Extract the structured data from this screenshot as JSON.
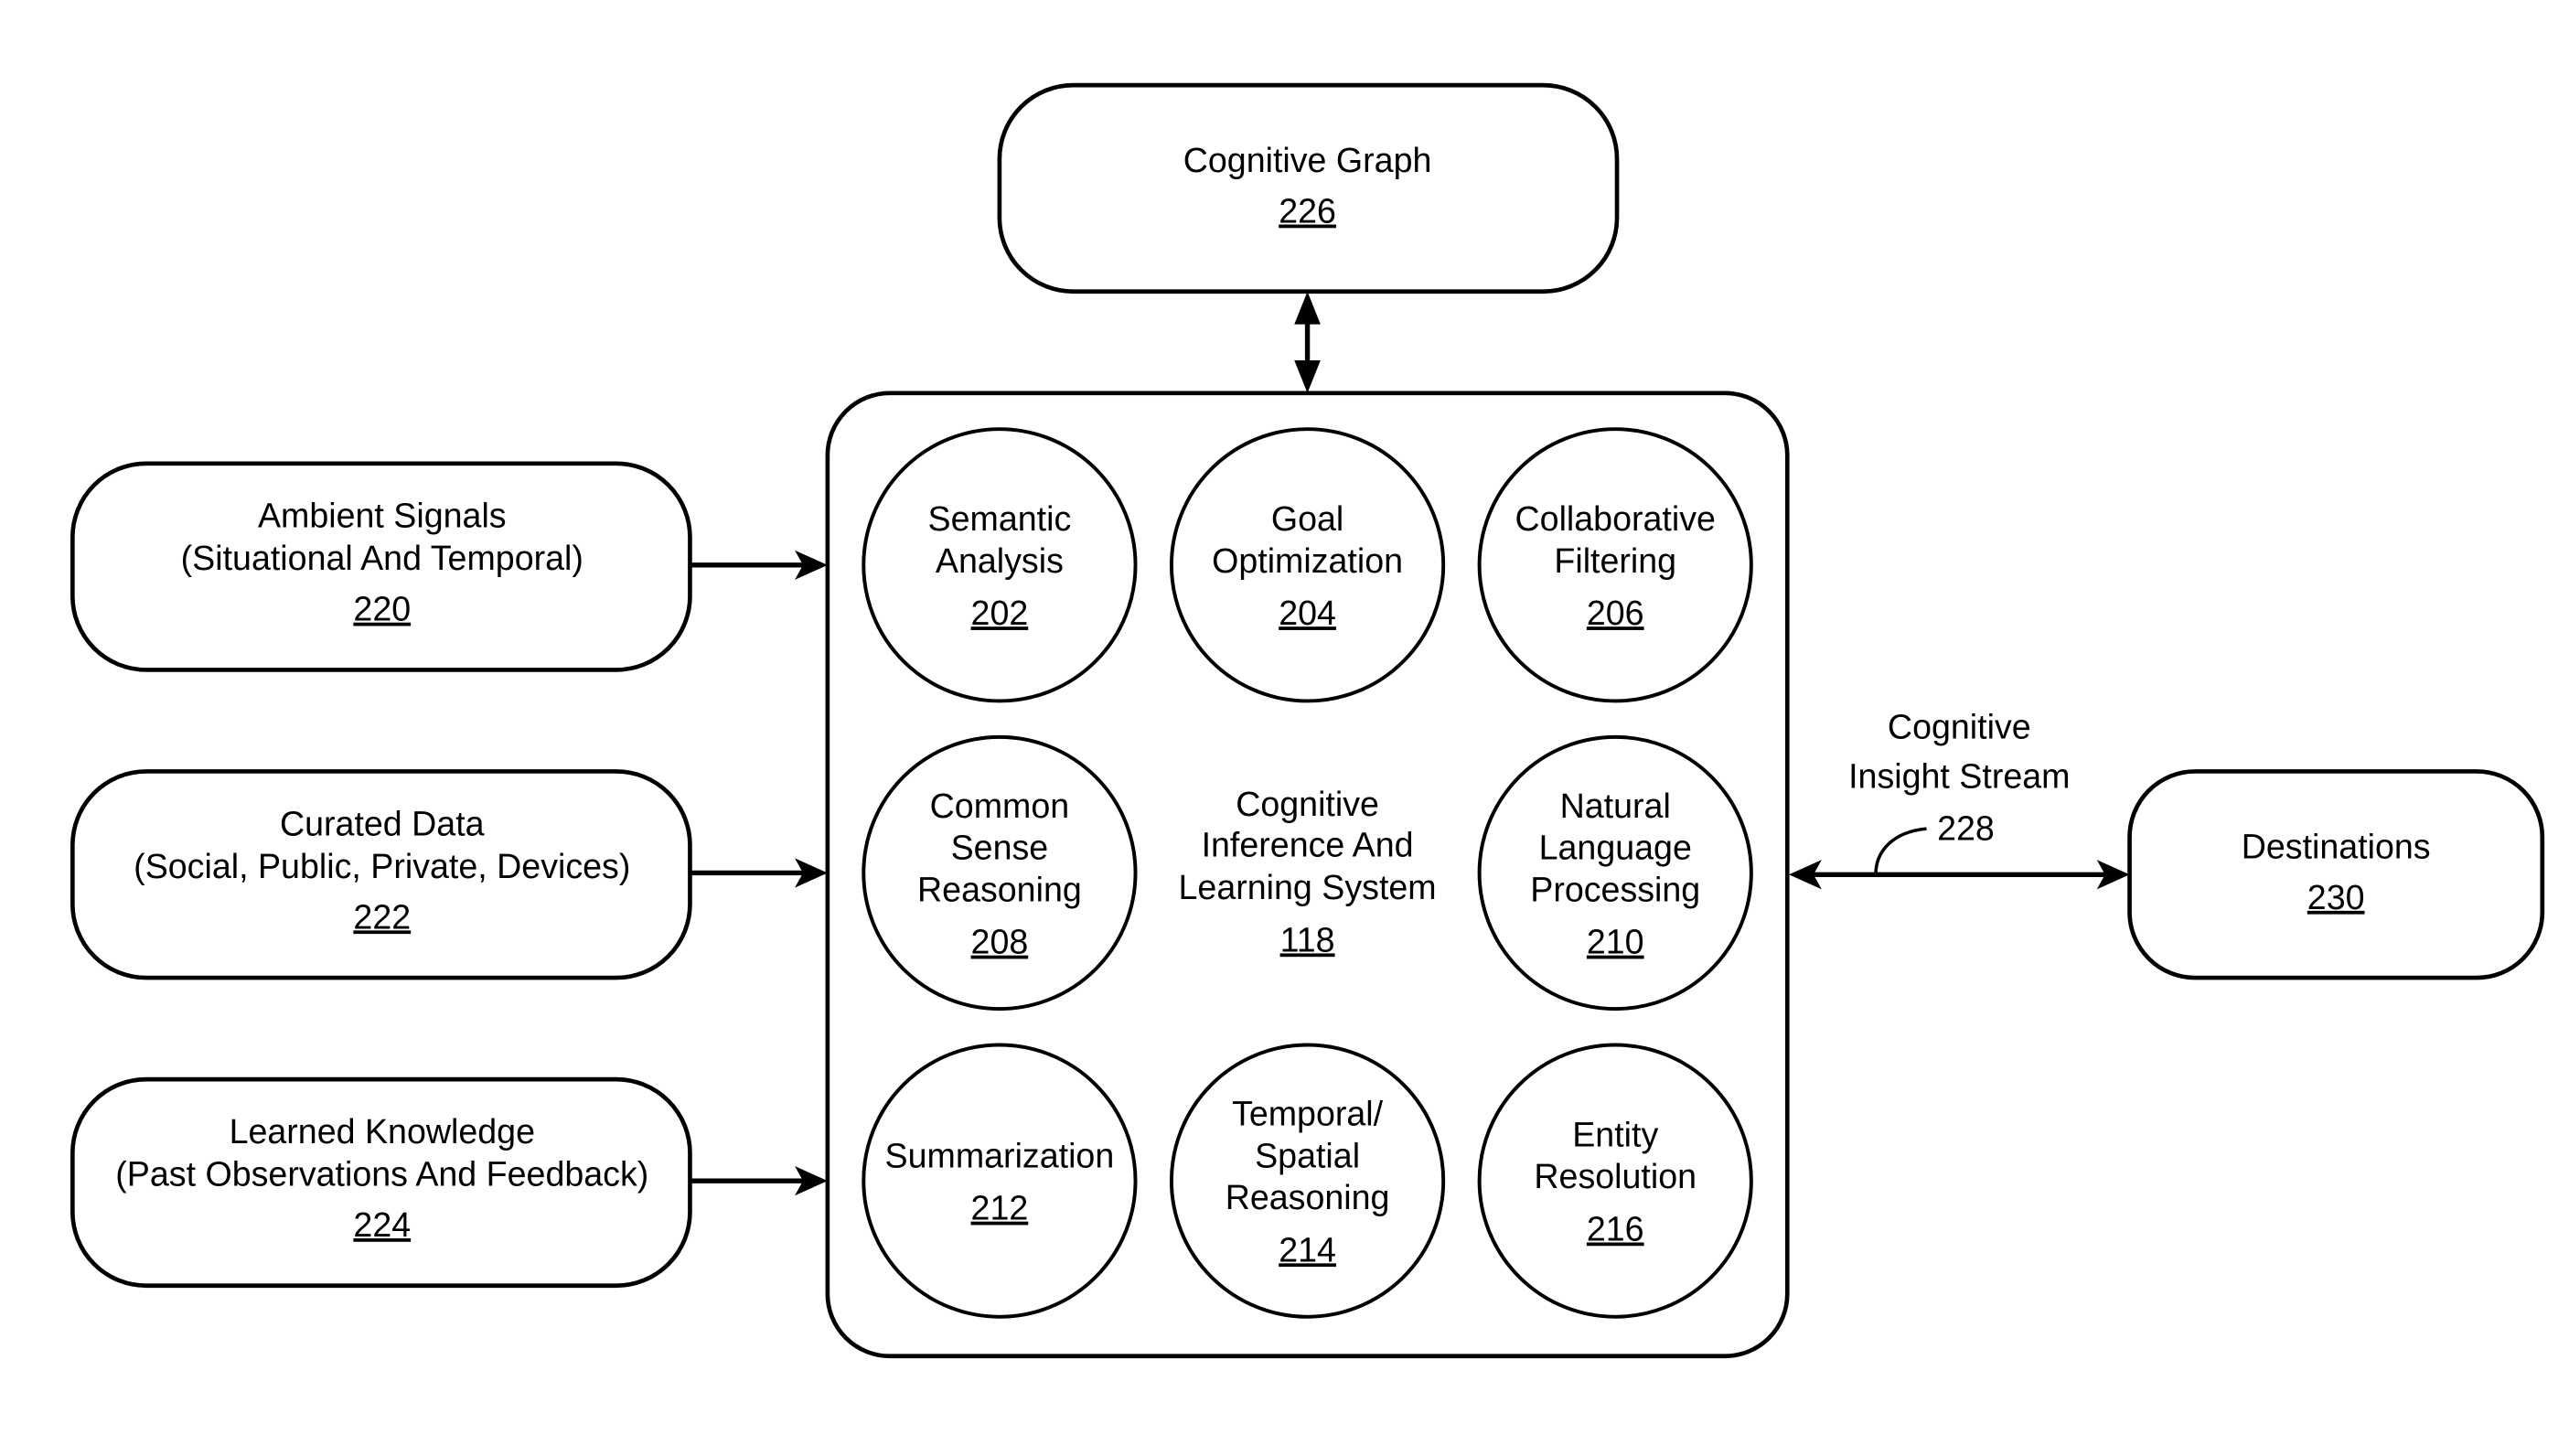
{
  "diagram": {
    "cognitive_graph": {
      "title": "Cognitive Graph",
      "ref": "226"
    },
    "inputs": [
      {
        "lines": [
          "Ambient Signals",
          "(Situational And Temporal)"
        ],
        "ref": "220"
      },
      {
        "lines": [
          "Curated Data",
          "(Social, Public, Private, Devices)"
        ],
        "ref": "222"
      },
      {
        "lines": [
          "Learned Knowledge",
          "(Past Observations And Feedback)"
        ],
        "ref": "224"
      }
    ],
    "system": {
      "lines": [
        "Cognitive",
        "Inference And",
        "Learning System"
      ],
      "ref": "118"
    },
    "modules": [
      {
        "lines": [
          "Semantic",
          "Analysis"
        ],
        "ref": "202"
      },
      {
        "lines": [
          "Goal",
          "Optimization"
        ],
        "ref": "204"
      },
      {
        "lines": [
          "Collaborative",
          "Filtering"
        ],
        "ref": "206"
      },
      {
        "lines": [
          "Common",
          "Sense",
          "Reasoning"
        ],
        "ref": "208"
      },
      {
        "lines": [
          "Natural",
          "Language",
          "Processing"
        ],
        "ref": "210"
      },
      {
        "lines": [
          "Summarization"
        ],
        "ref": "212"
      },
      {
        "lines": [
          "Temporal/",
          "Spatial",
          "Reasoning"
        ],
        "ref": "214"
      },
      {
        "lines": [
          "Entity",
          "Resolution"
        ],
        "ref": "216"
      }
    ],
    "stream": {
      "lines": [
        "Cognitive",
        "Insight Stream"
      ],
      "ref": "228"
    },
    "destinations": {
      "title": "Destinations",
      "ref": "230"
    }
  }
}
